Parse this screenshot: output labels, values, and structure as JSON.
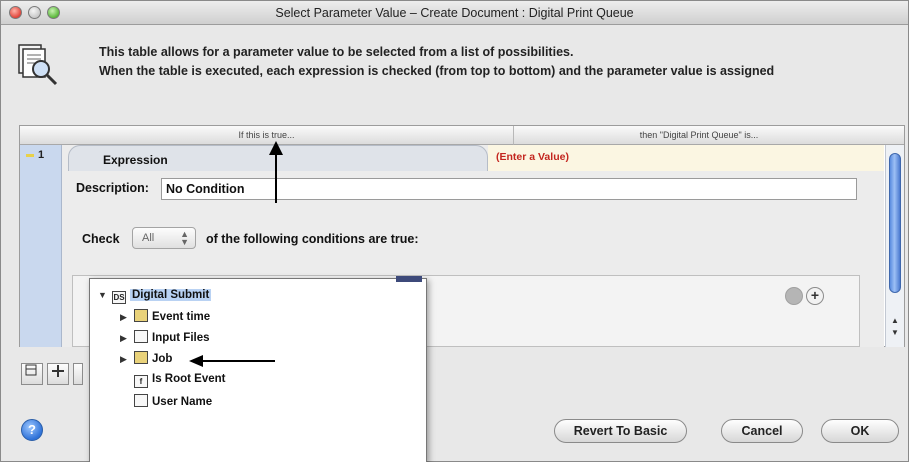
{
  "window": {
    "title": "Select Parameter Value – Create Document : Digital Print Queue"
  },
  "header": {
    "line1": "This table allows for a parameter value to be selected from a list of possibilities.",
    "line2": "When the table is executed, each expression is checked (from top to bottom) and the parameter value is assigned"
  },
  "table": {
    "col_left": "If this is true...",
    "col_right": "then \"Digital Print Queue\" is...",
    "row_number": "1",
    "expression_tab": "Expression",
    "enter_value": "(Enter a Value)"
  },
  "condition": {
    "description_label": "Description:",
    "description_value": "No Condition",
    "check_label": "Check",
    "check_value": "All",
    "check_suffix": "of the following conditions are true:"
  },
  "tree": {
    "root": "Digital Submit",
    "items": [
      {
        "label": "Event time",
        "expandable": true
      },
      {
        "label": "Input Files",
        "expandable": true
      },
      {
        "label": "Job",
        "expandable": true
      },
      {
        "label": "Is Root Event",
        "expandable": false
      },
      {
        "label": "User Name",
        "expandable": false
      }
    ]
  },
  "buttons": {
    "revert": "Revert To Basic",
    "cancel": "Cancel",
    "ok": "OK",
    "help": "?"
  },
  "icons": {
    "header": "document-magnifier-icon",
    "plus": "+",
    "accent": "#2f72d8"
  }
}
